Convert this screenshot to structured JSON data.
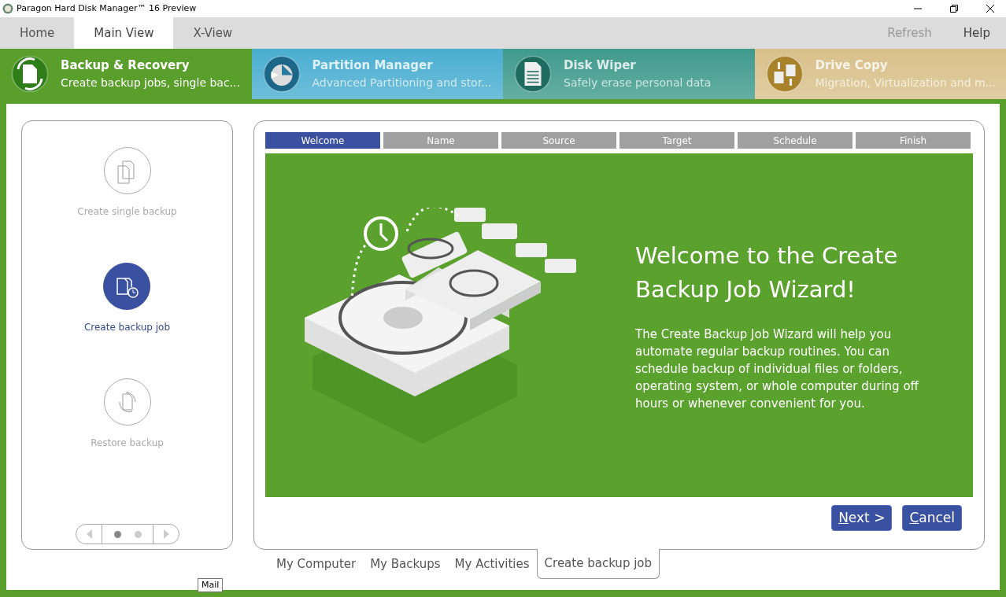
{
  "window": {
    "title": "Paragon Hard Disk Manager™ 16 Preview"
  },
  "menu_tabs": [
    {
      "label": "Home",
      "selected": false
    },
    {
      "label": "Main View",
      "selected": true
    },
    {
      "label": "X-View",
      "selected": false
    }
  ],
  "menu_actions": [
    {
      "label": "Refresh",
      "disabled": true
    },
    {
      "label": "Help",
      "disabled": false
    }
  ],
  "modules": [
    {
      "kind": "backup",
      "title": "Backup & Recovery",
      "subtitle": "Create backup jobs, single bac...",
      "selected": true,
      "color": "#5a9e2c"
    },
    {
      "kind": "partition",
      "title": "Partition Manager",
      "subtitle": "Advanced Partitioning and stor...",
      "selected": false,
      "color": "#4aaed0"
    },
    {
      "kind": "wiper",
      "title": "Disk Wiper",
      "subtitle": "Safely erase personal data",
      "selected": false,
      "color": "#3f9a8c"
    },
    {
      "kind": "copy",
      "title": "Drive Copy",
      "subtitle": "Migration, Virtualization and m...",
      "selected": false,
      "color": "#d8c08a"
    }
  ],
  "actions": [
    {
      "kind": "single",
      "label": "Create single backup",
      "selected": false
    },
    {
      "kind": "job",
      "label": "Create backup job",
      "selected": true
    },
    {
      "kind": "restore",
      "label": "Restore backup",
      "selected": false
    }
  ],
  "pager": {
    "pages": [
      {
        "selected": true
      },
      {
        "selected": false
      }
    ]
  },
  "wizard": {
    "steps": [
      {
        "label": "Welcome",
        "selected": true
      },
      {
        "label": "Name",
        "selected": false
      },
      {
        "label": "Source",
        "selected": false
      },
      {
        "label": "Target",
        "selected": false
      },
      {
        "label": "Schedule",
        "selected": false
      },
      {
        "label": "Finish",
        "selected": false
      }
    ],
    "heading": "Welcome to the Create Backup Job Wizard!",
    "body": "The Create Backup Job Wizard will help you automate regular backup routines. You can schedule backup of individual files or folders, operating system, or whole computer during off hours or whenever convenient for you.",
    "buttons": [
      {
        "label": "Next >",
        "underline_first": true
      },
      {
        "label": "Cancel",
        "underline_first": true
      }
    ]
  },
  "bottom_tabs": [
    {
      "label": "My Computer",
      "selected": false
    },
    {
      "label": "My Backups",
      "selected": false
    },
    {
      "label": "My Activities",
      "selected": false
    },
    {
      "label": "Create backup job",
      "selected": true
    }
  ],
  "tooltip": "Mail"
}
